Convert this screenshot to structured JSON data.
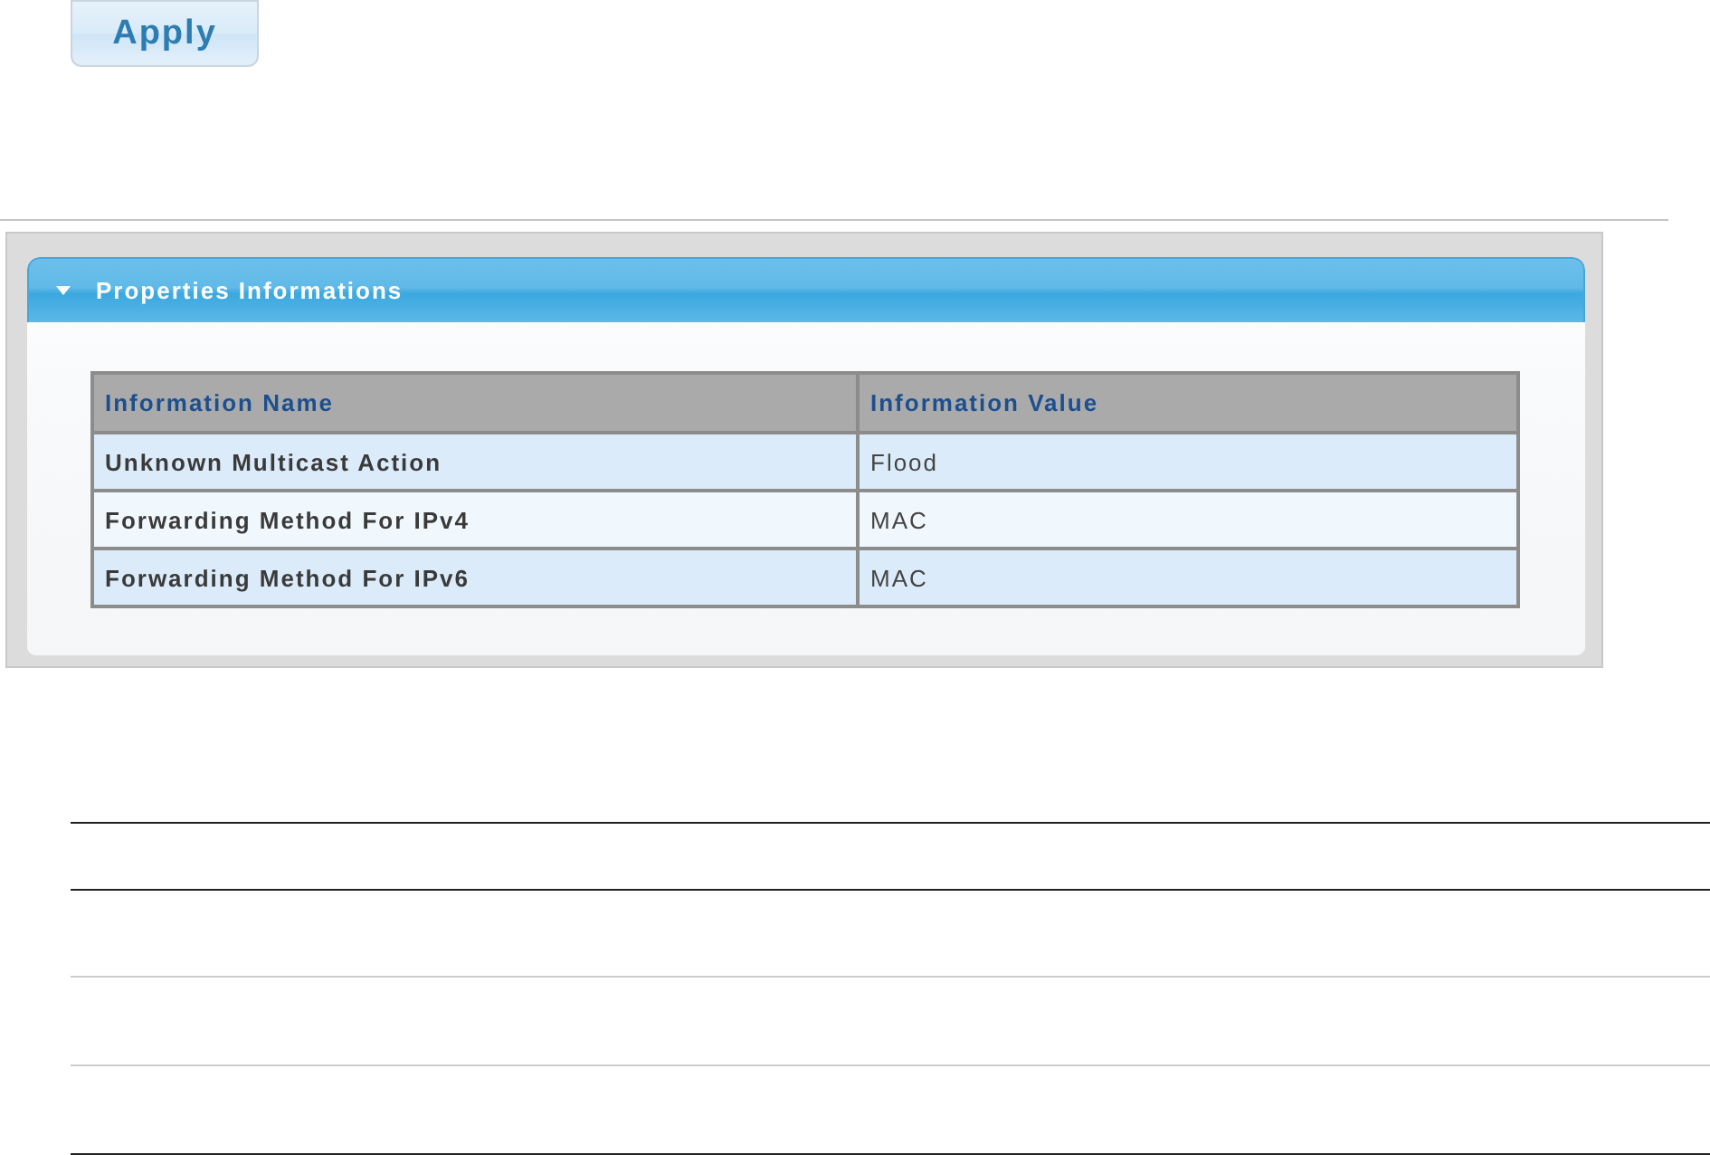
{
  "apply_button": {
    "label": "Apply"
  },
  "panel": {
    "title": "Properties Informations",
    "expanded": true
  },
  "table": {
    "columns": [
      "Information Name",
      "Information Value"
    ],
    "rows": [
      {
        "name": "Unknown Multicast Action",
        "value": "Flood"
      },
      {
        "name": "Forwarding Method For IPv4",
        "value": "MAC"
      },
      {
        "name": "Forwarding Method For IPv6",
        "value": "MAC"
      }
    ]
  }
}
